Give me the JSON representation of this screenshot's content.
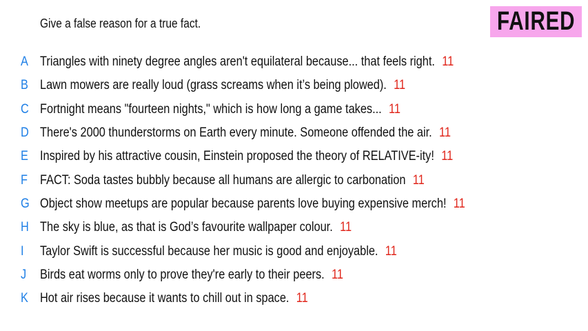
{
  "prompt": "Give a false reason for a true fact.",
  "badge": "FAIRED",
  "colors": {
    "letter": "#1e7fe6",
    "score": "#e0261b",
    "badge_bg": "#f7a6ec"
  },
  "answers": [
    {
      "letter": "A",
      "text": "Triangles with ninety degree angles aren't equilateral because... that feels right.",
      "score": "11"
    },
    {
      "letter": "B",
      "text": "Lawn mowers are really loud (grass screams when it’s being plowed).",
      "score": "11"
    },
    {
      "letter": "C",
      "text": "Fortnight means \"fourteen nights,\" which is how long a game takes...",
      "score": "11"
    },
    {
      "letter": "D",
      "text": "There's 2000 thunderstorms on Earth every minute. Someone offended the air.",
      "score": "11"
    },
    {
      "letter": "E",
      "text": "Inspired by his attractive cousin, Einstein proposed the theory of RELATIVE-ity!",
      "score": "11"
    },
    {
      "letter": "F",
      "text": "FACT: Soda tastes bubbly because all humans are allergic to carbonation",
      "score": "11"
    },
    {
      "letter": "G",
      "text": "Object show meetups are popular because parents love buying expensive merch!",
      "score": "11"
    },
    {
      "letter": "H",
      "text": "The sky is blue, as that is God’s favourite wallpaper colour.",
      "score": "11"
    },
    {
      "letter": "I",
      "text": "Taylor Swift is successful because her music is good and enjoyable.",
      "score": "11"
    },
    {
      "letter": "J",
      "text": "Birds eat worms only to prove they're early to their peers.",
      "score": "11"
    },
    {
      "letter": "K",
      "text": "Hot air rises because it wants to chill out in space.",
      "score": "11"
    }
  ]
}
